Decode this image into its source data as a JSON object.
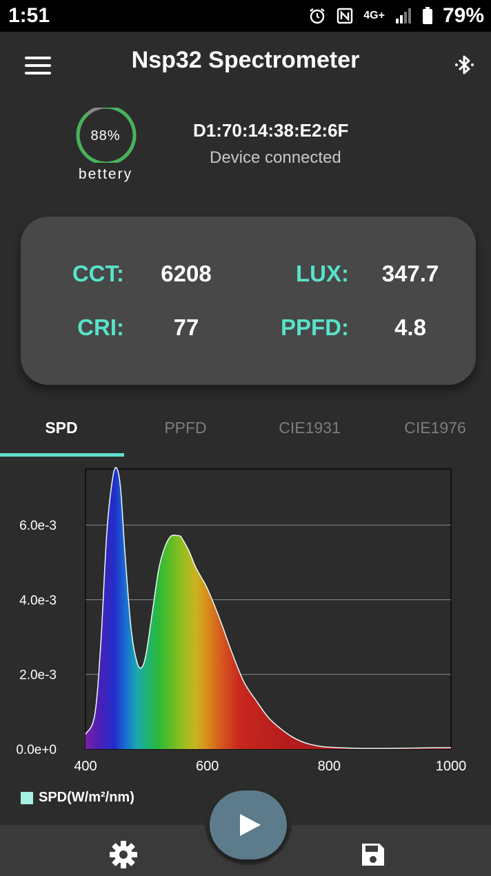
{
  "status_bar": {
    "time": "1:51",
    "network": "4G+",
    "battery": "79%"
  },
  "app_bar": {
    "title": "Nsp32 Spectrometer",
    "menu_icon": "hamburger-menu-icon",
    "bluetooth_icon": "bluetooth-icon"
  },
  "device": {
    "battery_percent_text": "88%",
    "battery_level": 0.88,
    "battery_label": "bettery",
    "id": "D1:70:14:38:E2:6F",
    "status": "Device connected"
  },
  "metrics": {
    "cct_label": "CCT:",
    "cct_value": "6208",
    "lux_label": "LUX:",
    "lux_value": "347.7",
    "cri_label": "CRI:",
    "cri_value": "77",
    "ppfd_label": "PPFD:",
    "ppfd_value": "4.8"
  },
  "tabs": [
    {
      "label": "SPD",
      "active": true
    },
    {
      "label": "PPFD",
      "active": false
    },
    {
      "label": "CIE1931",
      "active": false
    },
    {
      "label": "CIE1976",
      "active": false
    }
  ],
  "colors": {
    "accent": "#58e3c9",
    "background": "#2c2c2c",
    "card": "#484848",
    "fab": "#5c7b8b"
  },
  "chart_data": {
    "type": "area",
    "xlabel": "",
    "ylabel": "",
    "xlim": [
      400,
      1000
    ],
    "ylim": [
      0,
      0.0075
    ],
    "x_ticks": [
      "400",
      "600",
      "800",
      "1000"
    ],
    "y_ticks": [
      "0.0e+0",
      "2.0e-3",
      "4.0e-3",
      "6.0e-3"
    ],
    "grid": true,
    "legend": "bottom-left",
    "series": [
      {
        "name": "SPD(W/m²/nm)",
        "x": [
          400,
          415,
          425,
          435,
          445,
          452,
          458,
          465,
          475,
          485,
          493,
          500,
          510,
          520,
          530,
          540,
          550,
          556,
          560,
          570,
          580,
          590,
          600,
          620,
          640,
          660,
          680,
          700,
          720,
          740,
          760,
          780,
          800,
          850,
          900,
          950,
          1000
        ],
        "y": [
          0.0004,
          0.0009,
          0.0028,
          0.0058,
          0.0073,
          0.0075,
          0.0069,
          0.0052,
          0.0032,
          0.0023,
          0.0022,
          0.0026,
          0.0037,
          0.0048,
          0.0054,
          0.0057,
          0.00572,
          0.0057,
          0.0056,
          0.0053,
          0.0049,
          0.0046,
          0.0043,
          0.0035,
          0.0026,
          0.0018,
          0.0013,
          0.00085,
          0.00055,
          0.00032,
          0.00017,
          9e-05,
          5e-05,
          2e-05,
          2e-05,
          3e-05,
          4e-05
        ]
      }
    ]
  },
  "bottom_bar": {
    "settings_icon": "gear-icon",
    "play_icon": "play-icon",
    "save_icon": "floppy-disk-icon"
  }
}
